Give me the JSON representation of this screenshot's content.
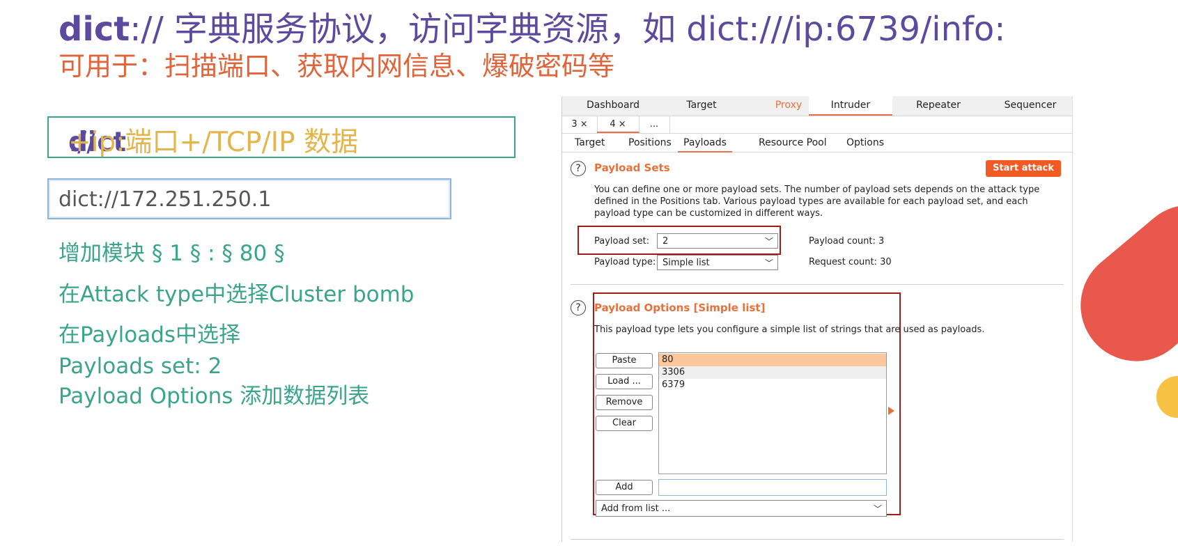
{
  "slide": {
    "title_bold": "dict",
    "title_rest": "://  字典服务协议，访问字典资源，如 dict:///ip:6739/info:",
    "subtitle": "可用于：扫描端口、获取内网信息、爆破密码等",
    "format": {
      "bold": "dict",
      "slashes": "://",
      "rest": "+ip:端口+/TCP/IP 数据"
    },
    "example_url": "dict://172.251.250.1",
    "steps": [
      "增加模块 § 1 § : § 80 §",
      "在Attack type中选择Cluster bomb",
      "在Payloads中选择",
      "Payloads set: 2",
      "Payload Options 添加数据列表"
    ],
    "colors": {
      "title": "#5b4a9e",
      "subtitle": "#e0633a",
      "steps": "#3aa58a",
      "accent": "#e3b54b"
    }
  },
  "burp": {
    "main_tabs": [
      "Dashboard",
      "Target",
      "Proxy",
      "Intruder",
      "Repeater",
      "Sequencer"
    ],
    "active_main_tab": "Intruder",
    "sub_tabs": [
      "3 ×",
      "4 ×",
      "..."
    ],
    "config_tabs": [
      "Target",
      "Positions",
      "Payloads",
      "Resource Pool",
      "Options"
    ],
    "active_config_tab": "Payloads",
    "payload_sets": {
      "title": "Payload Sets",
      "description": "You can define one or more payload sets. The number of payload sets depends on the attack type defined in the Positions tab. Various payload types are available for each payload set, and each payload type can be customized in different ways.",
      "start_attack": "Start attack",
      "payload_set_label": "Payload set:",
      "payload_set_value": "2",
      "payload_type_label": "Payload type:",
      "payload_type_value": "Simple list",
      "payload_count_label": "Payload count:",
      "payload_count_value": "3",
      "request_count_label": "Request count:",
      "request_count_value": "30"
    },
    "payload_options": {
      "title": "Payload Options [Simple list]",
      "description": "This payload type lets you configure a simple list of strings that are used as payloads.",
      "buttons": [
        "Paste",
        "Load ...",
        "Remove",
        "Clear"
      ],
      "items": [
        "80",
        "3306",
        "6379"
      ],
      "selected_item": "80",
      "add_label": "Add",
      "add_input_value": "",
      "add_from_list": "Add from list ..."
    },
    "icons": {
      "help": "?",
      "chevron": "﹀",
      "close": "×"
    }
  }
}
